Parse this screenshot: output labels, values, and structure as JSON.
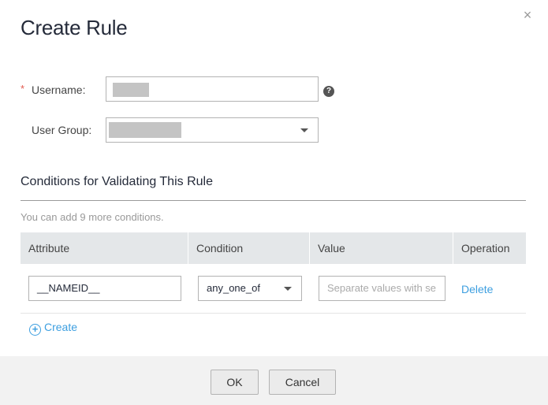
{
  "dialog": {
    "title": "Create Rule",
    "close_label": "×"
  },
  "form": {
    "username": {
      "label": "Username:",
      "required_mark": "*",
      "help_symbol": "?"
    },
    "user_group": {
      "label": "User Group:"
    }
  },
  "conditions": {
    "section_title": "Conditions for Validating This Rule",
    "hint": "You can add 9 more conditions.",
    "columns": [
      "Attribute",
      "Condition",
      "Value",
      "Operation"
    ],
    "rows": [
      {
        "attribute": "__NAMEID__",
        "condition": "any_one_of",
        "value_placeholder": "Separate values with se",
        "operation": "Delete"
      }
    ],
    "create_label": "Create",
    "create_icon": "plus-circle-icon"
  },
  "footer": {
    "ok_label": "OK",
    "cancel_label": "Cancel"
  },
  "colors": {
    "link": "#3d9fe0",
    "required": "#e25a4f",
    "table_header_bg": "#e4e7e9",
    "footer_bg": "#f2f2f2"
  }
}
